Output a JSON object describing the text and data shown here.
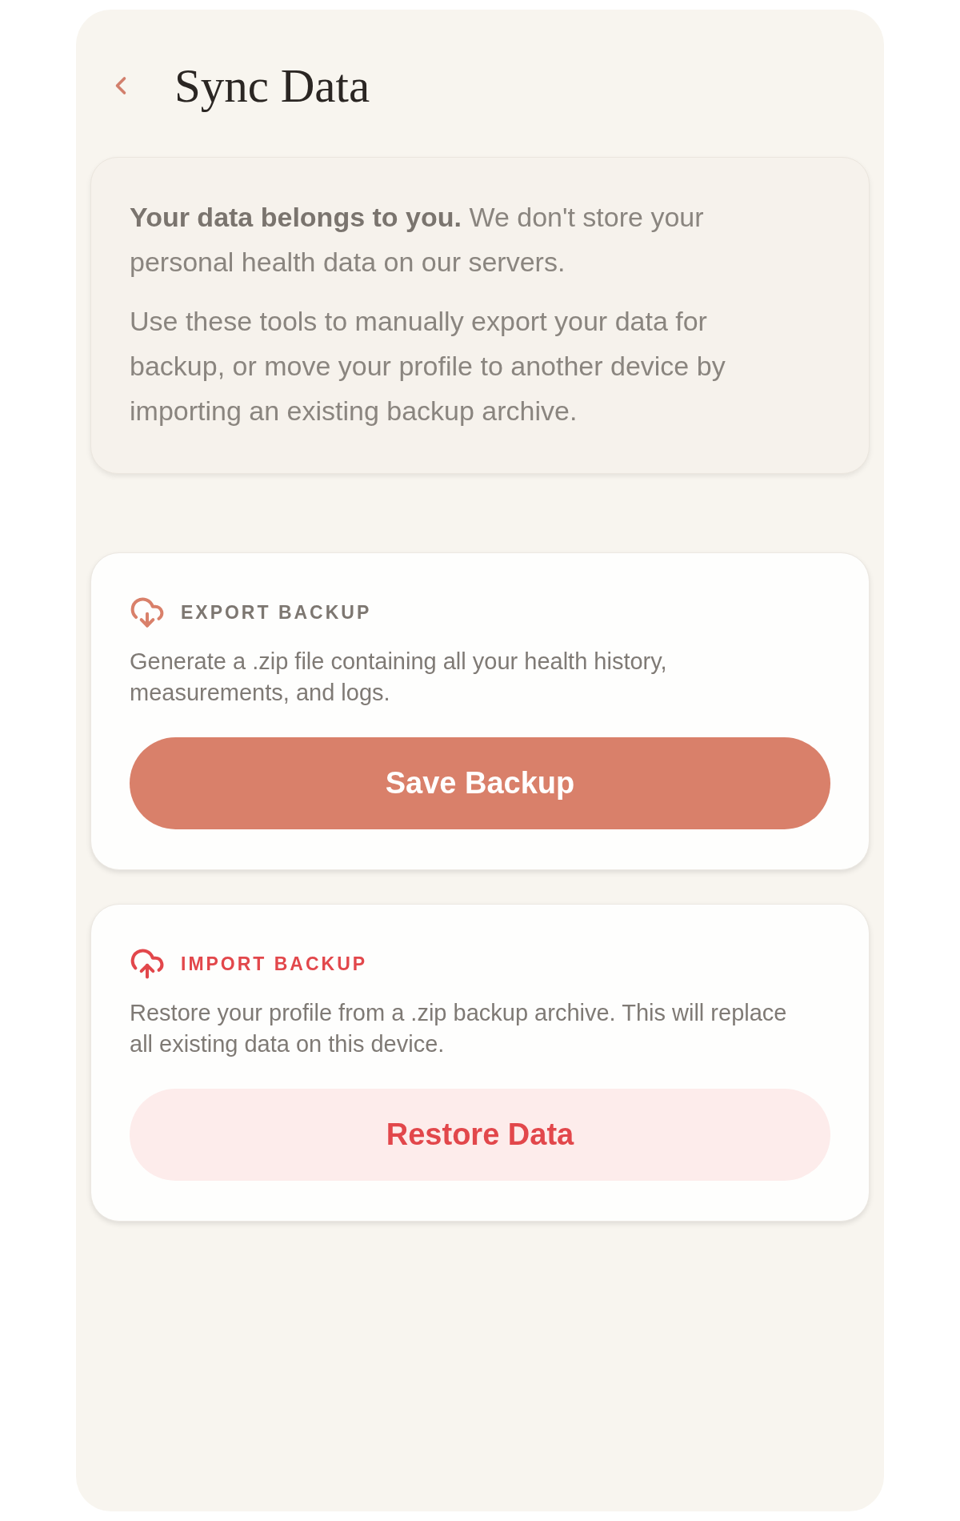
{
  "header": {
    "title": "Sync Data"
  },
  "intro": {
    "paragraphs": [
      "**Your data belongs to you.** We don't store your personal health data on our servers.",
      "Use these tools to manually export your data for backup, or move your profile to another device by importing an existing backup archive."
    ]
  },
  "sections": [
    {
      "kind": "export",
      "title": "EXPORT BACKUP",
      "description": "Generate a .zip file containing all your health history, measurements, and logs.",
      "button": "Save Backup"
    },
    {
      "kind": "import",
      "title": "IMPORT BACKUP",
      "description": "Restore your profile from a .zip backup archive. This will replace all existing data on this device.",
      "button": "Restore Data"
    }
  ]
}
